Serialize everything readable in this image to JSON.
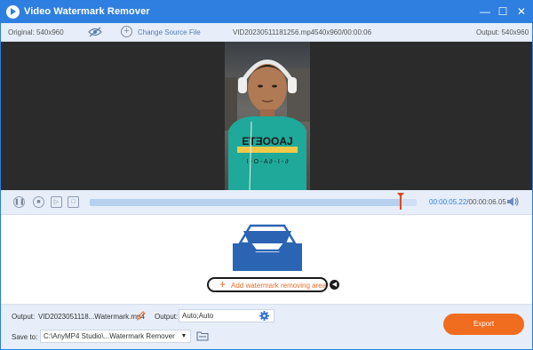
{
  "titlebar": {
    "title": "Video Watermark Remover",
    "minimize": "—",
    "maximize": "☐",
    "close": "✕"
  },
  "infobar": {
    "original": "Original: 540x960",
    "change_source": "Change Source File",
    "file_name": "VID20230511181256.mp4",
    "file_meta": "540x960/00:00:06",
    "output": "Output: 540x960"
  },
  "timeline": {
    "current_time": "00:00:05.22",
    "separator": "/",
    "total_time": "00:00:06.05",
    "progress_fraction": 0.95
  },
  "editor": {
    "add_area_label": "Add watermark removing area"
  },
  "bottom": {
    "output_label": "Output:",
    "output_file": "VID2023051118...Watermark.mp4",
    "output_format_label": "Output:",
    "output_format_value": "Auto;Auto",
    "save_to_label": "Save to:",
    "save_path": "C:\\AnyMP4 Studio\\...Watermark Remover",
    "export_label": "Export"
  },
  "colors": {
    "accent": "#2f7fe0",
    "export": "#f06c1e",
    "playhead": "#e0461e",
    "tray": "#2b64b3"
  }
}
